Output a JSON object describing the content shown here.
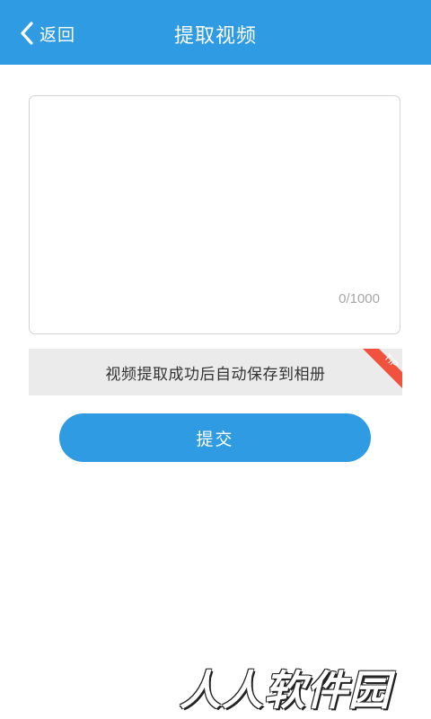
{
  "header": {
    "back_label": "返回",
    "title": "提取视频",
    "background": "#2f9be3"
  },
  "input": {
    "counter": "0/1000"
  },
  "tip": {
    "text": "视频提取成功后自动保存到相册",
    "badge": "TIP",
    "badge_color": "#f0523d"
  },
  "actions": {
    "submit_label": "提交"
  },
  "watermark": {
    "text": "人人软件园"
  }
}
